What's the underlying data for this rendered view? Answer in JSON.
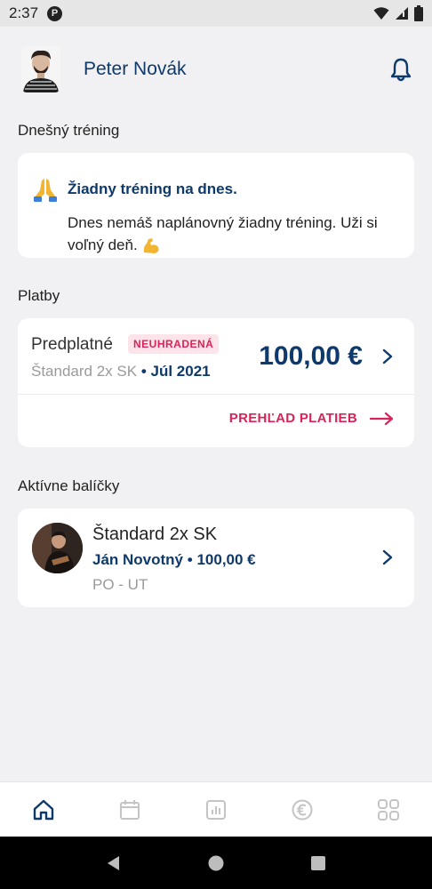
{
  "status": {
    "time": "2:37",
    "app_icon_letter": "P"
  },
  "header": {
    "user_name": "Peter Novák",
    "avatar_icon": "user-avatar",
    "bell_icon": "bell-icon"
  },
  "today": {
    "section_title": "Dnešný tréning",
    "title": "Žiadny tréning na dnes.",
    "text": "Dnes nemáš naplánovný žiadny tréning. Uži si voľný deň.",
    "title_icon": "praying-hands-emoji",
    "text_icon": "flexed-biceps-emoji"
  },
  "payments": {
    "section_title": "Platby",
    "label": "Predplatné",
    "badge": "NEUHRADENÁ",
    "plan": "Štandard 2x SK",
    "separator": "•",
    "period": "Júl 2021",
    "amount": "100,00 €",
    "overview_link": "PREHĽAD PLATIEB"
  },
  "packages": {
    "section_title": "Aktívne balíčky",
    "items": [
      {
        "name": "Štandard 2x SK",
        "coach": "Ján Novotný",
        "separator": "•",
        "price": "100,00 €",
        "days": "PO - UT"
      }
    ]
  },
  "bottom_nav": [
    "home-icon",
    "calendar-icon",
    "stats-icon",
    "euro-icon",
    "grid-icon"
  ],
  "colors": {
    "primary": "#0e3a6b",
    "accent": "#d8245a",
    "background": "#f1f1f3",
    "card": "#ffffff"
  }
}
